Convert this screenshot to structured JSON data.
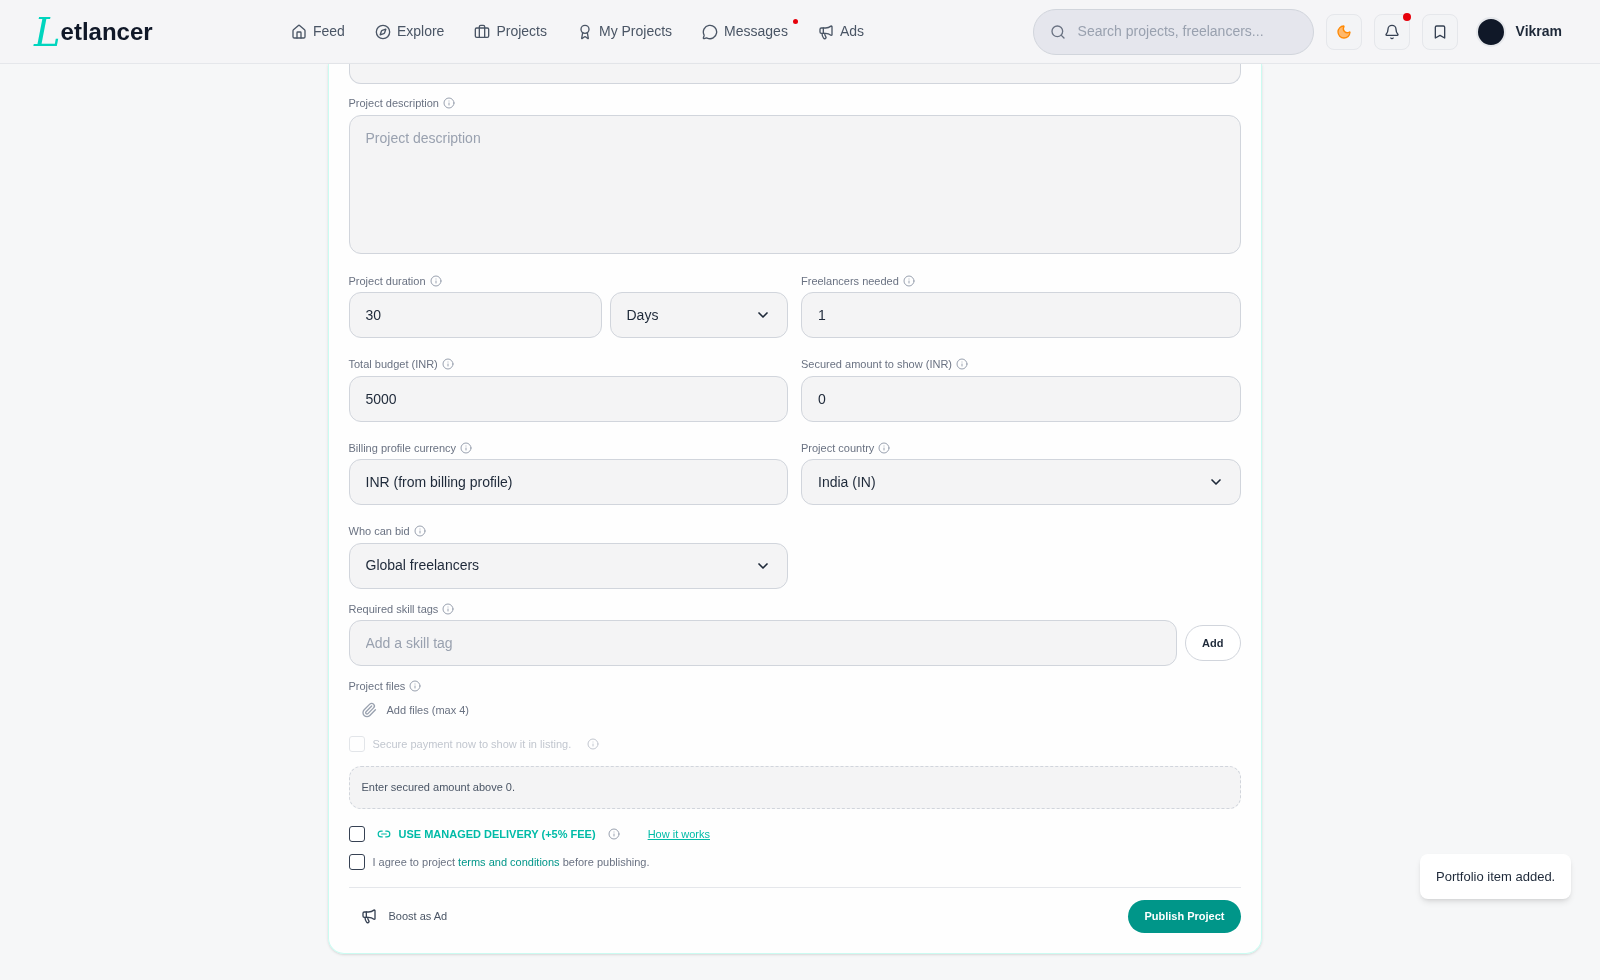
{
  "brand": {
    "logo_letter": "L",
    "name": "etlancer"
  },
  "nav": [
    {
      "label": "Feed",
      "selected": false,
      "badge": false
    },
    {
      "label": "Explore",
      "selected": false,
      "badge": false
    },
    {
      "label": "Projects",
      "selected": false,
      "badge": false
    },
    {
      "label": "My Projects",
      "selected": false,
      "badge": false
    },
    {
      "label": "Messages",
      "selected": false,
      "badge": true
    },
    {
      "label": "Ads",
      "selected": false,
      "badge": false
    }
  ],
  "search": {
    "placeholder": "Search projects, freelancers..."
  },
  "notifications": {
    "unread": true
  },
  "user": {
    "name": "Vikram"
  },
  "form": {
    "description": {
      "label": "Project description",
      "placeholder": "Project description"
    },
    "duration": {
      "label": "Project duration",
      "value": "30",
      "unit": "Days"
    },
    "freelancers": {
      "label": "Freelancers needed",
      "value": "1"
    },
    "budget": {
      "label": "Total budget (INR)",
      "value": "5000"
    },
    "secured": {
      "label": "Secured amount to show (INR)",
      "value": "0"
    },
    "currency": {
      "label": "Billing profile currency",
      "value": "INR (from billing profile)"
    },
    "country": {
      "label": "Project country",
      "value": "India (IN)"
    },
    "who_can_bid": {
      "label": "Who can bid",
      "value": "Global freelancers"
    },
    "skills": {
      "label": "Required skill tags",
      "placeholder": "Add a skill tag",
      "button": "Add"
    },
    "files": {
      "label": "Project files",
      "button": "Add files (max 4)"
    },
    "secure_payment": {
      "label": "Secure payment now to show it in listing.",
      "checked": false,
      "disabled": true
    },
    "notice": "Enter secured amount above 0.",
    "managed": {
      "label": "USE MANAGED DELIVERY (+5% FEE)",
      "checked": false,
      "link": "How it works"
    },
    "agree": {
      "before": "I agree to project ",
      "link": "terms and conditions",
      "after": " before publishing.",
      "checked": false
    },
    "boost": "Boost as Ad",
    "publish": "Publish Project"
  },
  "toast": "Portfolio item added."
}
